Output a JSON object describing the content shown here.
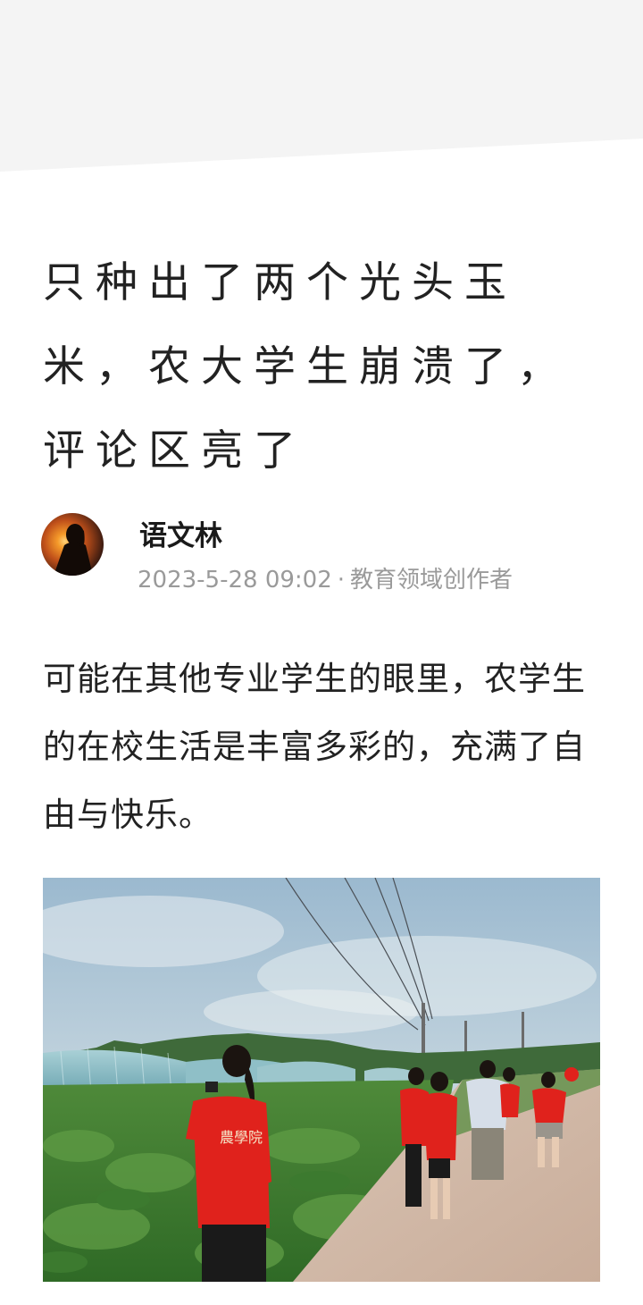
{
  "article": {
    "title": "只种出了两个光头玉米，农大学生崩溃了，评论区亮了",
    "author": {
      "name": "语文林",
      "timestamp": "2023-5-28 09:02",
      "separator": "·",
      "tag": "教育领域创作者"
    },
    "paragraph": "可能在其他专业学生的眼里，农学生的在校生活是丰富多彩的，充满了自由与快乐。"
  },
  "photo": {
    "shirt_print": "農學院"
  },
  "colors": {
    "text": "#222222",
    "meta": "#9a9a9a",
    "shirt": "#e0221c"
  }
}
